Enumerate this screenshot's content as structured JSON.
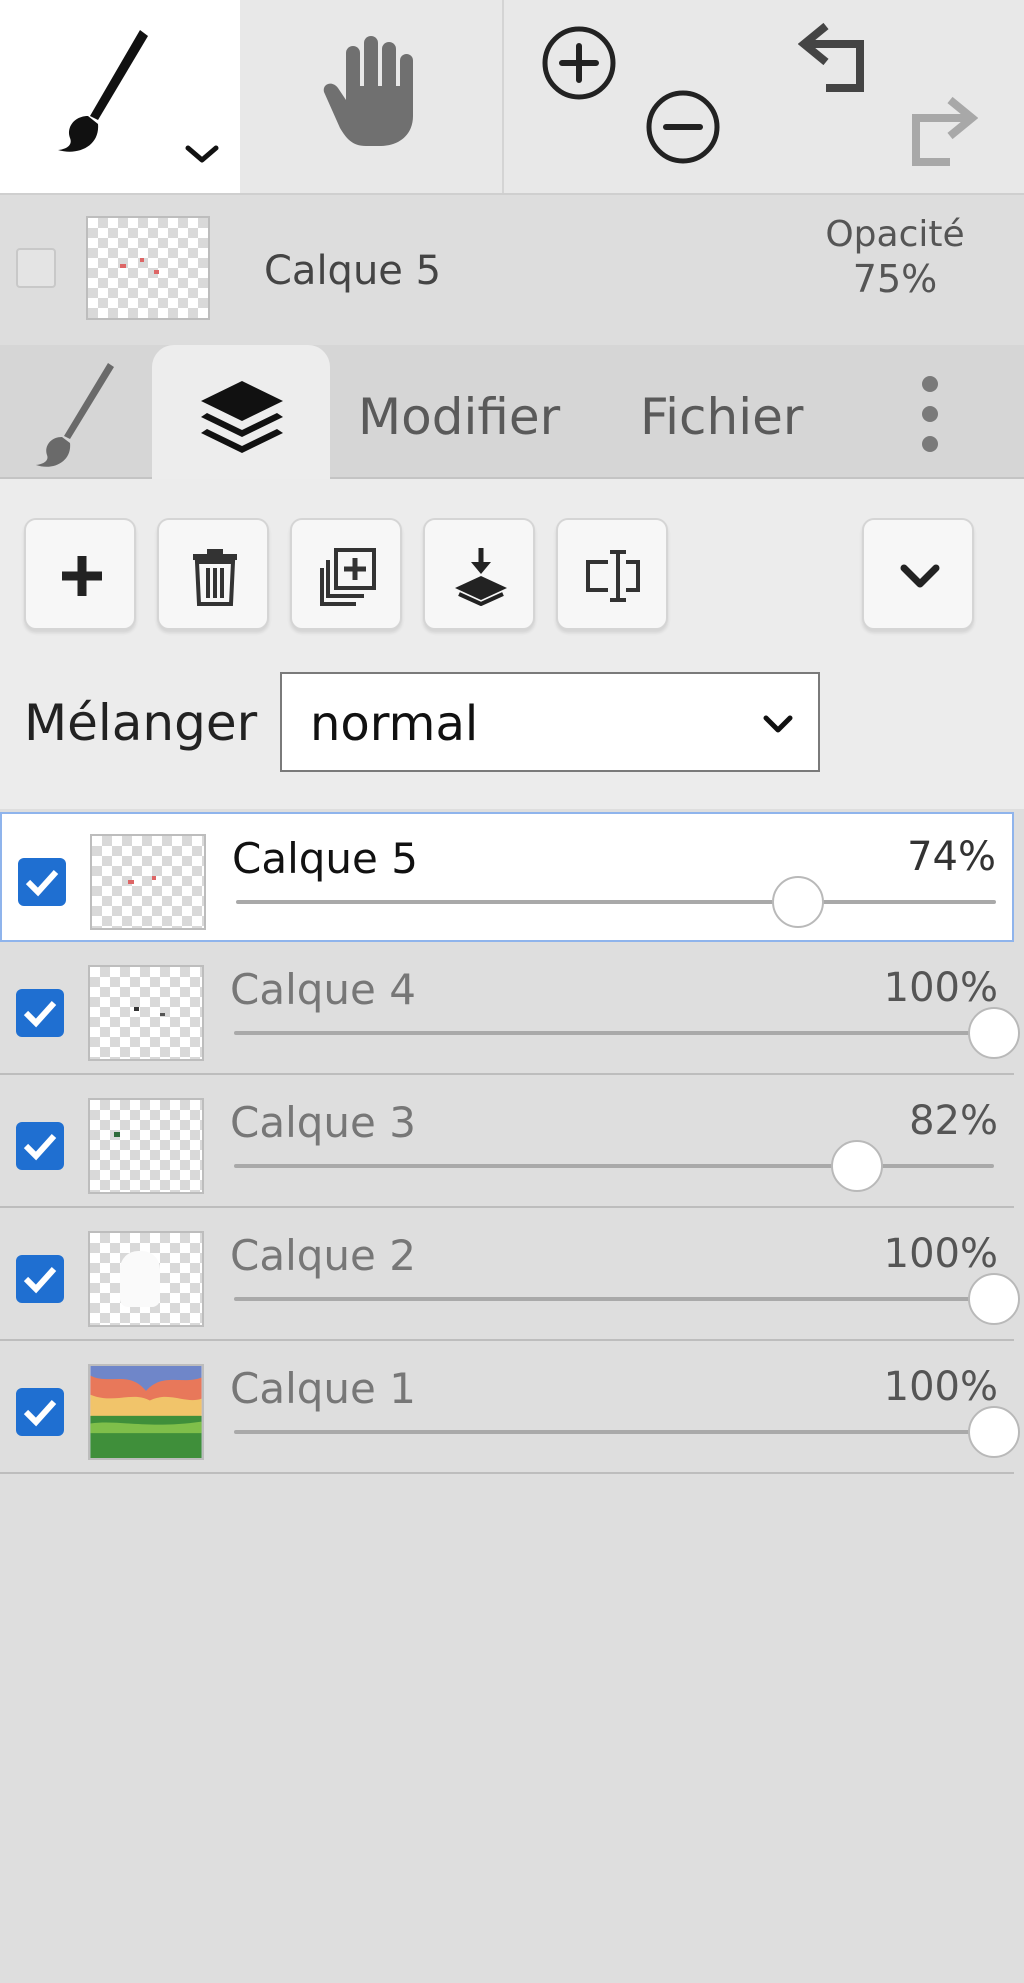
{
  "toolbar": {
    "tools": [
      {
        "icon": "brush-icon",
        "selected": true
      },
      {
        "icon": "hand-icon",
        "selected": false
      }
    ],
    "actions": [
      "zoom-in-icon",
      "zoom-out-icon",
      "undo-icon",
      "redo-icon"
    ]
  },
  "current_layer": {
    "name": "Calque 5",
    "opacity_label": "Opacité",
    "opacity_value": "75%"
  },
  "tabs": {
    "brush_icon": "brush-icon",
    "layers_icon": "layers-icon",
    "modifier": "Modifier",
    "fichier": "Fichier",
    "more_icon": "more-vertical-icon"
  },
  "layer_actions": [
    "add-layer-icon",
    "delete-layer-icon",
    "duplicate-layer-icon",
    "merge-down-icon",
    "rename-layer-icon",
    "chevron-down-icon"
  ],
  "blend": {
    "label": "Mélanger",
    "value": "normal"
  },
  "layers": [
    {
      "name": "Calque 5",
      "opacity": "74%",
      "level": 0.74,
      "visible": true,
      "selected": true
    },
    {
      "name": "Calque 4",
      "opacity": "100%",
      "level": 1.0,
      "visible": true,
      "selected": false
    },
    {
      "name": "Calque 3",
      "opacity": "82%",
      "level": 0.82,
      "visible": true,
      "selected": false
    },
    {
      "name": "Calque 2",
      "opacity": "100%",
      "level": 1.0,
      "visible": true,
      "selected": false
    },
    {
      "name": "Calque 1",
      "opacity": "100%",
      "level": 1.0,
      "visible": true,
      "selected": false
    }
  ],
  "colors": {
    "accent": "#1f6fd1",
    "selected_row_border": "#8fb4ec"
  }
}
